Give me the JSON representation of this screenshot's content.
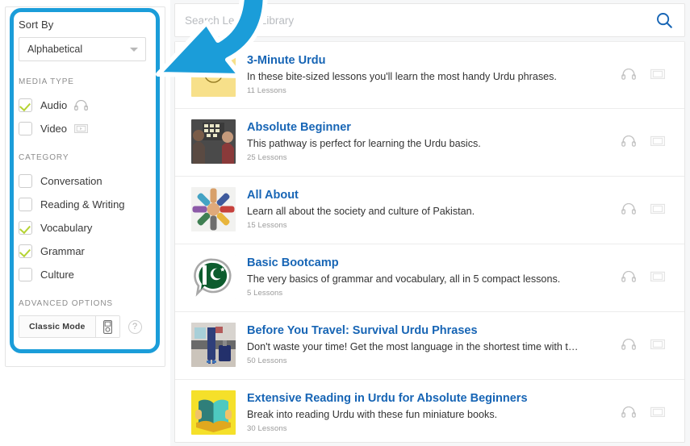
{
  "sidebar": {
    "sort": {
      "label": "Sort By",
      "selected": "Alphabetical",
      "caret_icon": "chevron-down-icon"
    },
    "media_type": {
      "title": "MEDIA TYPE",
      "items": [
        {
          "label": "Audio",
          "checked": true,
          "icon": "headphones-icon"
        },
        {
          "label": "Video",
          "checked": false,
          "icon": "video-film-icon"
        }
      ]
    },
    "category": {
      "title": "CATEGORY",
      "items": [
        {
          "label": "Conversation",
          "checked": false
        },
        {
          "label": "Reading & Writing",
          "checked": false
        },
        {
          "label": "Vocabulary",
          "checked": true
        },
        {
          "label": "Grammar",
          "checked": true
        },
        {
          "label": "Culture",
          "checked": false
        }
      ]
    },
    "advanced": {
      "title": "ADVANCED OPTIONS",
      "classic_mode_label": "Classic Mode",
      "device_icon": "ipod-device-icon",
      "help_label": "?"
    }
  },
  "search": {
    "placeholder": "Search Lesson Library",
    "icon": "search-icon"
  },
  "colors": {
    "accent_blue": "#1b9dd9",
    "link_blue": "#1765b5",
    "check_green": "#b5d334",
    "page_bg": "#f6f7f8"
  },
  "lessons": [
    {
      "title": "3-Minute Urdu",
      "description": "In these bite-sized lessons you'll learn the most handy Urdu phrases.",
      "count": "11 Lessons",
      "thumb": "yellow-numbered-one",
      "audio_icon": "headphones-icon",
      "video_icon": "video-film-icon"
    },
    {
      "title": "Absolute Beginner",
      "description": "This pathway is perfect for learning the Urdu basics.",
      "count": "25 Lessons",
      "thumb": "photo-two-people-sticky-notes",
      "audio_icon": "headphones-icon",
      "video_icon": "video-film-icon"
    },
    {
      "title": "All About",
      "description": "Learn all about the society and culture of Pakistan.",
      "count": "15 Lessons",
      "thumb": "photo-hands-circle",
      "audio_icon": "headphones-icon",
      "video_icon": "video-film-icon"
    },
    {
      "title": "Basic Bootcamp",
      "description": "The very basics of grammar and vocabulary, all in 5 compact lessons.",
      "count": "5 Lessons",
      "thumb": "speech-bubble-pakistan-flag",
      "audio_icon": "headphones-icon",
      "video_icon": "video-film-icon"
    },
    {
      "title": "Before You Travel: Survival Urdu Phrases",
      "description": "Don't waste your time! Get the most language in the shortest time with t…",
      "count": "50 Lessons",
      "thumb": "photo-traveler-suitcase",
      "audio_icon": "headphones-icon",
      "video_icon": "video-film-icon"
    },
    {
      "title": "Extensive Reading in Urdu for Absolute Beginners",
      "description": "Break into reading Urdu with these fun miniature books.",
      "count": "30 Lessons",
      "thumb": "yellow-open-book",
      "audio_icon": "headphones-icon",
      "video_icon": "video-film-icon"
    }
  ],
  "annotation": {
    "arrow_icon": "curved-blue-arrow-pointing-to-filters"
  }
}
